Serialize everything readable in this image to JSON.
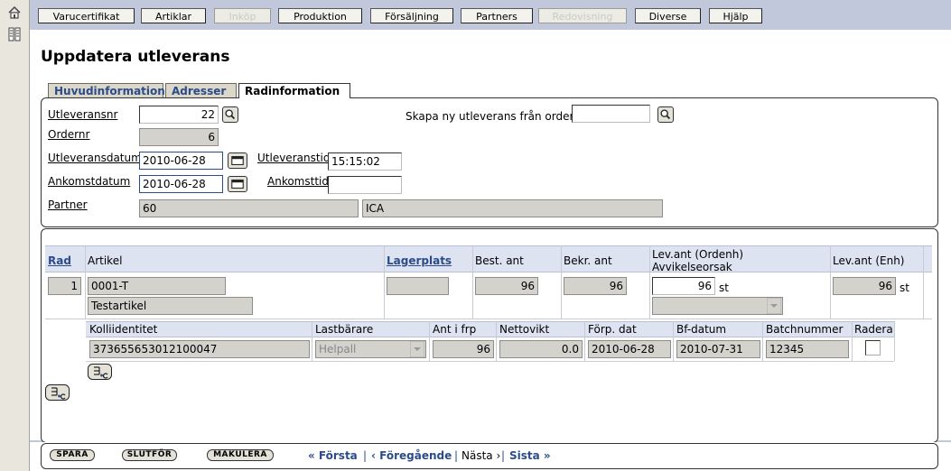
{
  "nav": {
    "items": [
      {
        "label": "Varucertifikat",
        "enabled": true
      },
      {
        "label": "Artiklar",
        "enabled": true
      },
      {
        "label": "Inköp",
        "enabled": false
      },
      {
        "label": "Produktion",
        "enabled": true
      },
      {
        "label": "Försäljning",
        "enabled": true
      },
      {
        "label": "Partners",
        "enabled": true
      },
      {
        "label": "Redovisning",
        "enabled": false
      },
      {
        "label": "Diverse",
        "enabled": true
      },
      {
        "label": "Hjälp",
        "enabled": true
      }
    ]
  },
  "page": {
    "title": "Uppdatera utleverans"
  },
  "tabs": [
    {
      "label": "Huvudinformation"
    },
    {
      "label": "Adresser"
    },
    {
      "label": "Radinformation"
    }
  ],
  "header": {
    "utleveransnr_label": "Utleveransnr",
    "utleveransnr_value": "22",
    "skapa_label": "Skapa ny utleverans från order",
    "skapa_value": "",
    "ordernr_label": "Ordernr",
    "ordernr_value": "6",
    "utleveransdatum_label": "Utleveransdatum",
    "utleveransdatum_value": "2010-06-28",
    "utleveranstid_label": "Utleveranstid",
    "utleveranstid_value": "15:15:02",
    "ankomstdatum_label": "Ankomstdatum",
    "ankomstdatum_value": "2010-06-28",
    "ankomsttid_label": "Ankomsttid",
    "ankomsttid_value": "",
    "partner_label": "Partner",
    "partner_id": "60",
    "partner_name": "ICA"
  },
  "rows_table": {
    "headers": {
      "rad": "Rad",
      "artikel": "Artikel",
      "lagerplats": "Lagerplats",
      "best_ant": "Best. ant",
      "bekr_ant": "Bekr. ant",
      "lev_ant_ordenh": "Lev.ant (Ordenh)",
      "avvikelseorsak": "Avvikelseorsak",
      "lev_ant_enh": "Lev.ant (Enh)"
    },
    "row": {
      "rad": "1",
      "artikel_nr": "0001-T",
      "artikel_namn": "Testartikel",
      "lagerplats": "",
      "best_ant": "96",
      "bekr_ant": "96",
      "lev_ant_ordenh": "96",
      "unit1": "st",
      "avvikelseorsak": "",
      "lev_ant_enh": "96",
      "unit2": "st"
    }
  },
  "kolli_table": {
    "headers": {
      "kolliidentitet": "Kolliidentitet",
      "lastbarare": "Lastbärare",
      "ant_i_frp": "Ant i frp",
      "nettovikt": "Nettovikt",
      "forp_dat": "Förp. dat",
      "bf_datum": "Bf-datum",
      "batchnummer": "Batchnummer",
      "radera": "Radera"
    },
    "row": {
      "kolliidentitet": "373655653012100047",
      "lastbarare": "Helpall",
      "ant_i_frp": "96",
      "nettovikt": "0.0",
      "forp_dat": "2010-06-28",
      "bf_datum": "2010-07-31",
      "batchnummer": "12345"
    }
  },
  "footer": {
    "spara": "SPARA",
    "slutfor": "SLUTFÖR",
    "makulera": "MAKULERA",
    "forsta": "« Första",
    "foregaende": "‹ Föregående",
    "nasta": "Nästa ›",
    "sista": "Sista »",
    "sep1": "|",
    "sep2": "|",
    "sep3": "|"
  }
}
